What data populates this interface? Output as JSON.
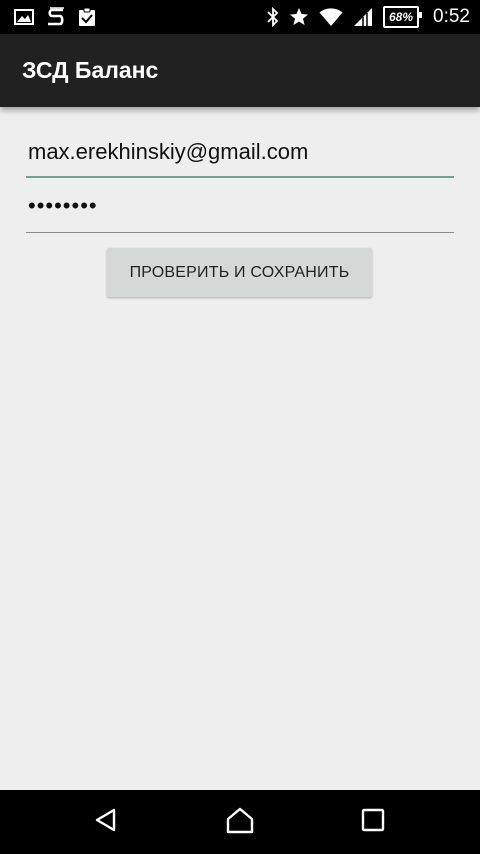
{
  "status_bar": {
    "left_icons": [
      "gallery-notification-icon",
      "s-app-notification-icon",
      "clipboard-check-notification-icon"
    ],
    "right_icons": [
      "bluetooth-icon",
      "star-icon",
      "wifi-icon",
      "signal-icon"
    ],
    "battery": "68%",
    "time": "0:52"
  },
  "app_bar": {
    "title": "ЗСД Баланс"
  },
  "form": {
    "email_value": "max.erekhinskiy@gmail.com",
    "password_masked": "••••••••",
    "save_label": "ПРОВЕРИТЬ И СОХРАНИТЬ"
  },
  "nav_bar": {
    "buttons": [
      "back-icon",
      "home-icon",
      "recents-icon"
    ]
  },
  "colors": {
    "accent": "#6aa592",
    "app_bar": "#212121",
    "background": "#eeeeee",
    "button": "#d6d7d7"
  }
}
